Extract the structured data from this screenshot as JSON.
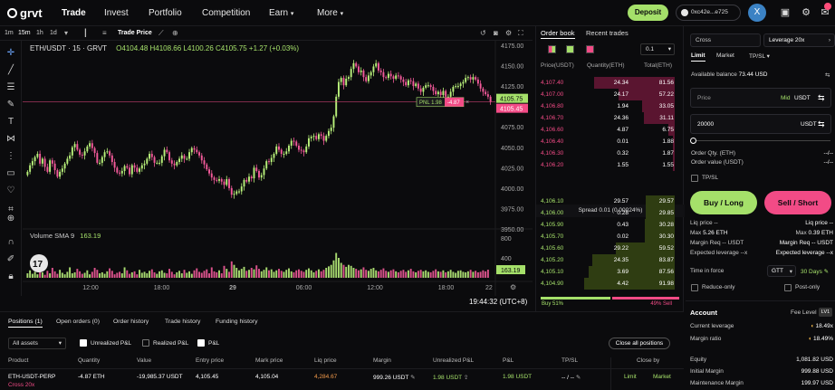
{
  "nav": {
    "logo": "grvt",
    "items": [
      "Trade",
      "Invest",
      "Portfolio",
      "Competition",
      "Earn",
      "More"
    ],
    "deposit": "Deposit",
    "wallet": "0xc42e...e725",
    "avatar": "X"
  },
  "toolbar": {
    "timeframes": [
      "1m",
      "15m",
      "1h",
      "1d"
    ],
    "price_mode": "Trade Price"
  },
  "chart": {
    "symbol": "ETH/USDT · 15 · GRVT",
    "ohlc": "O4104.48 H4108.66 L4100.26 C4105.75 +1.27 (+0.03%)",
    "volume_label": "Volume  SMA 9",
    "volume_value": "163.19",
    "pnl_label": "PNL 1.98",
    "pnl_qty": "-4.87",
    "price_tag_1": "4105.75",
    "price_tag_2": "4105.45",
    "volume_tag": "163.19",
    "time_readout": "19:44:32 (UTC+8)",
    "corner_tag": "22"
  },
  "chart_data": {
    "type": "candlestick",
    "ylim": [
      3950,
      4175
    ],
    "yticks": [
      4175,
      4150,
      4125,
      4100,
      4075,
      4050,
      4025,
      4000,
      3975,
      3950
    ],
    "ytick_labels": [
      "4175.00",
      "4150.00",
      "4125.00",
      "4100.00",
      "4075.00",
      "4050.00",
      "4025.00",
      "4000.00",
      "3975.00",
      "3950.00"
    ],
    "volume_ylim": [
      0,
      800
    ],
    "volume_ticks": [
      800,
      400
    ],
    "xtick_labels": [
      "12:00",
      "18:00",
      "29",
      "06:00",
      "12:00",
      "18:00"
    ],
    "close": [
      4020,
      4028,
      4033,
      4038,
      4042,
      4030,
      4036,
      4026,
      4020,
      4034,
      4030,
      4022,
      4014,
      4020,
      4024,
      4030,
      4036,
      4040,
      4050,
      4054,
      4047,
      4041,
      4040,
      4045,
      4051,
      4055,
      4049,
      4043,
      4031,
      4031,
      4038,
      4044,
      4045,
      4040,
      4032,
      4025,
      4019,
      4018,
      4021,
      4027,
      4025,
      4017,
      4028,
      4025,
      4020,
      4024,
      4028,
      4030,
      4036,
      4042,
      4038,
      4031,
      4031,
      4031,
      4039,
      4047,
      4044,
      4034,
      4030,
      4028,
      4032,
      4036,
      4040,
      4036,
      4036,
      4044,
      4049,
      4047,
      4044,
      4040,
      4034,
      4029,
      4023,
      4018,
      4013,
      4010,
      4009,
      4011,
      4008,
      4004,
      4011,
      4000,
      3992,
      3993,
      3996,
      3996,
      4002,
      4010,
      4008,
      4014,
      4012,
      4025,
      4021,
      4013,
      4016,
      4024,
      4033,
      4032,
      4037,
      4042,
      4051,
      4047,
      4042,
      4042,
      4045,
      4052,
      4058,
      4057,
      4052,
      4047,
      4046,
      4044,
      4051,
      4061,
      4063,
      4064,
      4060,
      4066,
      4064,
      4058,
      4064,
      4070,
      4074,
      4088,
      4112,
      4130,
      4135,
      4126,
      4134,
      4136,
      4146,
      4153,
      4149,
      4142,
      4144,
      4136,
      4131,
      4138,
      4142,
      4149,
      4153,
      4144,
      4142,
      4136,
      4135,
      4140,
      4137,
      4134,
      4138,
      4137,
      4133,
      4130,
      4126,
      4132,
      4131,
      4125,
      4128,
      4122,
      4118,
      4123,
      4126,
      4126,
      4124,
      4119,
      4115,
      4118,
      4114,
      4119,
      4112,
      4112,
      4118,
      4124,
      4125,
      4125,
      4128,
      4130,
      4135,
      4136,
      4133,
      4136,
      4133,
      4128,
      4122,
      4118,
      4115,
      4112,
      4106
    ],
    "volume": [
      90,
      150,
      80,
      120,
      70,
      180,
      110,
      60,
      140,
      90,
      200,
      130,
      80,
      160,
      100,
      70,
      120,
      210,
      90,
      110,
      180,
      130,
      80,
      100,
      150,
      70,
      120,
      200,
      160,
      90,
      110,
      80,
      130,
      190,
      140,
      70,
      100,
      120,
      90,
      210,
      150,
      80,
      110,
      130,
      70,
      160,
      100,
      120,
      90,
      140,
      170,
      110,
      80,
      130,
      150,
      100,
      90,
      180,
      120,
      70,
      110,
      140,
      90,
      160,
      100,
      130,
      80,
      150,
      190,
      120,
      100,
      140,
      170,
      90,
      210,
      130,
      110,
      150,
      90,
      240,
      180,
      120,
      330,
      260,
      200,
      150,
      180,
      220,
      140,
      160,
      200,
      170,
      250,
      180,
      130,
      160,
      210,
      150,
      170,
      120,
      150,
      180,
      140,
      120,
      160,
      190,
      130,
      110,
      150,
      170,
      140,
      120,
      160,
      190,
      150,
      110,
      140,
      170,
      130,
      160,
      200,
      230,
      260,
      350,
      500,
      400,
      300,
      260,
      220,
      260,
      240,
      200,
      180,
      150,
      170,
      210,
      160,
      140,
      180,
      200,
      150,
      130,
      160,
      190,
      140,
      120,
      150,
      170,
      130,
      110,
      140,
      160,
      120,
      150,
      180,
      130,
      110,
      140,
      160,
      130,
      150,
      120,
      110,
      140,
      170,
      130,
      120,
      150,
      110,
      130,
      160,
      120,
      100,
      140,
      150,
      120,
      110,
      130,
      160,
      120,
      140,
      110,
      120,
      150,
      130,
      163
    ]
  },
  "orderbook": {
    "tabs": [
      "Order book",
      "Recent trades"
    ],
    "tick": "0.1",
    "headers": [
      "Price(USDT)",
      "Quantity(ETH)",
      "Total(ETH)"
    ],
    "asks": [
      {
        "price": "4,107.40",
        "qty": "24.34",
        "total": "81.56",
        "depth": 0.89
      },
      {
        "price": "4,107.00",
        "qty": "24.17",
        "total": "57.22",
        "depth": 0.62
      },
      {
        "price": "4,106.80",
        "qty": "1.94",
        "total": "33.05",
        "depth": 0.36
      },
      {
        "price": "4,106.70",
        "qty": "24.36",
        "total": "31.11",
        "depth": 0.34
      },
      {
        "price": "4,106.60",
        "qty": "4.87",
        "total": "6.75",
        "depth": 0.07
      },
      {
        "price": "4,106.40",
        "qty": "0.01",
        "total": "1.88",
        "depth": 0.02
      },
      {
        "price": "4,106.30",
        "qty": "0.32",
        "total": "1.87",
        "depth": 0.02
      },
      {
        "price": "4,106.20",
        "qty": "1.55",
        "total": "1.55",
        "depth": 0.02
      }
    ],
    "spread": "Spread  0.01 (0.00024%)",
    "bids": [
      {
        "price": "4,106.10",
        "qty": "29.57",
        "total": "29.57",
        "depth": 0.32
      },
      {
        "price": "4,106.00",
        "qty": "0.28",
        "total": "29.85",
        "depth": 0.32
      },
      {
        "price": "4,105.90",
        "qty": "0.43",
        "total": "30.28",
        "depth": 0.33
      },
      {
        "price": "4,105.70",
        "qty": "0.02",
        "total": "30.30",
        "depth": 0.33
      },
      {
        "price": "4,105.60",
        "qty": "29.22",
        "total": "59.52",
        "depth": 0.65
      },
      {
        "price": "4,105.20",
        "qty": "24.35",
        "total": "83.87",
        "depth": 0.91
      },
      {
        "price": "4,105.10",
        "qty": "3.69",
        "total": "87.56",
        "depth": 0.95
      },
      {
        "price": "4,104.90",
        "qty": "4.42",
        "total": "91.98",
        "depth": 1.0
      }
    ],
    "buy_ratio": "Buy 51%",
    "sell_ratio": "49% Sell",
    "buy_pct": 51
  },
  "trade": {
    "margin_mode": "Cross",
    "leverage": "Leverage 20x",
    "tabs": [
      "Limit",
      "Market",
      "TP/SL"
    ],
    "avail_label": "Available balance",
    "avail_value": "73.44 USD",
    "price_placeholder": "Price",
    "price_mid": "Mid",
    "price_unit": "USDT",
    "amount_value": "20000",
    "amount_unit": "USDT",
    "qty_label": "Order Qty. (ETH)",
    "qty_value": "--/--",
    "value_label": "Order value (USDT)",
    "value_value": "--/--",
    "tpsl": "TP/SL",
    "buy": "Buy / Long",
    "sell": "Sell / Short",
    "liq_long": "Liq price --",
    "liq_short": "Liq price --",
    "max_long_label": "Max",
    "max_long": "5.26 ETH",
    "max_short_label": "Max",
    "max_short": "0.39 ETH",
    "mreq_long": "Margin Req -- USDT",
    "mreq_short": "Margin Req -- USDT",
    "elev_long": "Expected leverage --x",
    "elev_short": "Expected leverage --x",
    "tif_label": "Time in force",
    "tif_value": "GTT",
    "tif_days": "30 Days",
    "reduce_only": "Reduce-only",
    "post_only": "Post-only",
    "account_title": "Account",
    "fee_level": "Fee Level",
    "fee_badge": "LV1",
    "cur_lev_label": "Current leverage",
    "cur_lev": "18.49x",
    "mratio_label": "Margin ratio",
    "mratio": "18.49%",
    "equity_label": "Equity",
    "equity": "1,081.82 USD",
    "init_margin_label": "Initial Margin",
    "init_margin": "999.88 USD",
    "maint_margin_label": "Maintenance Margin",
    "maint_margin": "199.97 USD"
  },
  "positions": {
    "tabs": [
      "Positions (1)",
      "Open orders (0)",
      "Order history",
      "Trade history",
      "Funding history"
    ],
    "filter": "All assets",
    "unrealized_pnl": "Unrealized P&L",
    "realized_pnl": "Realized P&L",
    "pnl": "P&L",
    "close_all": "Close all positions",
    "columns": [
      "Product",
      "Quantity",
      "Value",
      "Entry price",
      "Mark price",
      "Liq price",
      "Margin",
      "Unrealized P&L",
      "P&L",
      "TP/SL",
      "Close by"
    ],
    "row": {
      "product": "ETH-USDT-PERP",
      "mode": "Cross 20x",
      "qty": "-4.87 ETH",
      "value": "-19,985.37 USDT",
      "entry": "4,105.45",
      "mark": "4,105.04",
      "liq": "4,284.67",
      "margin": "999.26 USDT",
      "upnl": "1.98 USDT",
      "pnl": "1.98 USDT",
      "tpsl": "-- / --",
      "limit": "Limit",
      "market": "Market"
    }
  },
  "colors": {
    "accent_green": "#a5e06a",
    "accent_pink": "#f24b86",
    "candle_up": "#b8f07a",
    "candle_down": "#f25a9a",
    "background": "#0b0b0d"
  }
}
